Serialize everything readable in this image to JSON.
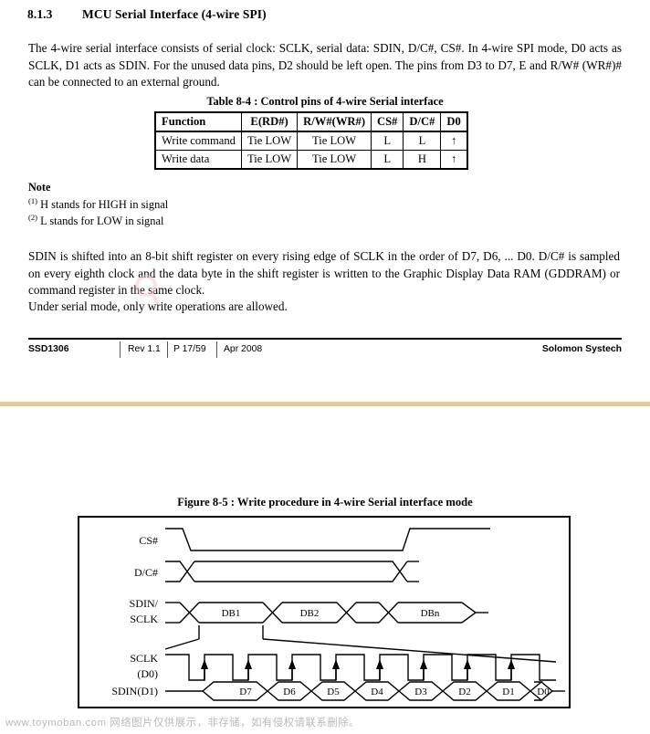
{
  "section": {
    "number": "8.1.3",
    "title": "MCU Serial Interface (4-wire SPI)"
  },
  "paragraphs": {
    "intro": "The 4-wire serial interface consists of serial clock: SCLK, serial data: SDIN, D/C#, CS#. In 4-wire SPI mode, D0 acts as SCLK, D1 acts as SDIN. For the unused data pins, D2 should be left open. The pins from D3 to D7, E and R/W# (WR#)# can be connected to an external ground.",
    "sdin": "SDIN is shifted into an 8-bit shift register on every rising edge of SCLK in the order of D7, D6, ... D0. D/C# is sampled on every eighth clock and the data byte in the shift register is written to the Graphic Display Data RAM (GDDRAM) or command register in the same clock.",
    "under": "Under serial mode, only write operations are allowed."
  },
  "table": {
    "caption": "Table 8-4 : Control pins of 4-wire Serial interface",
    "headers": [
      "Function",
      "E(RD#)",
      "R/W#(WR#)",
      "CS#",
      "D/C#",
      "D0"
    ],
    "rows": [
      [
        "Write command",
        "Tie LOW",
        "Tie LOW",
        "L",
        "L",
        "↑"
      ],
      [
        "Write data",
        "Tie LOW",
        "Tie LOW",
        "L",
        "H",
        "↑"
      ]
    ]
  },
  "note": {
    "title": "Note",
    "items": [
      {
        "marker": "(1)",
        "text": "H stands for HIGH in signal"
      },
      {
        "marker": "(2)",
        "text": "L stands for LOW in signal"
      }
    ]
  },
  "footer": {
    "part": "SSD1306",
    "rev": "Rev 1.1",
    "page": "P 17/59",
    "date": "Apr 2008",
    "company": "Solomon Systech"
  },
  "figure": {
    "caption": "Figure 8-5 : Write procedure in 4-wire Serial interface mode",
    "signals": [
      {
        "name": "cs",
        "label": "CS#"
      },
      {
        "name": "dc",
        "label": "D/C#"
      },
      {
        "name": "sdin-sclk",
        "label_line1": "SDIN/",
        "label_line2": "SCLK"
      },
      {
        "name": "sclk-d0",
        "label_line1": "SCLK",
        "label_line2": "(D0)"
      },
      {
        "name": "sdin-d1",
        "label": "SDIN(D1)"
      }
    ],
    "byte_labels": [
      "DB1",
      "DB2",
      "",
      "DBn"
    ],
    "bit_labels": [
      "D7",
      "D6",
      "D5",
      "D4",
      "D3",
      "D2",
      "D1",
      "D0"
    ],
    "clock_pulses": 8
  },
  "watermark": {
    "bottom_text": "www.toymoban.com 网络图片仅供展示，非存储，如有侵权请联系删除。",
    "accent_color": "#f3c7cc"
  },
  "colors": {
    "divider": "#e2caa0",
    "text": "#000000",
    "watermark_gray": "#b9b9b9"
  }
}
